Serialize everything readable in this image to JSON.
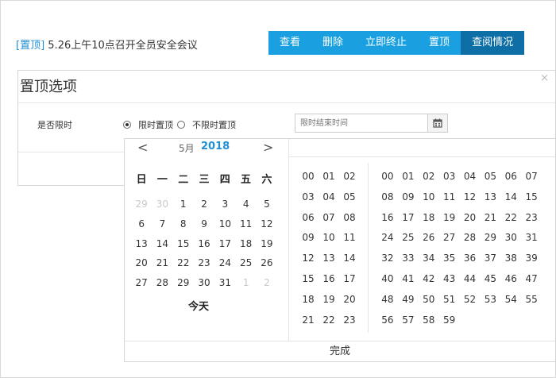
{
  "notice": {
    "tag": "[置顶]",
    "text": " 5.26上午10点召开全员安全会议"
  },
  "toolbar": {
    "buttons": [
      "查看",
      "删除",
      "立即终止",
      "置顶",
      "查阅情况"
    ]
  },
  "modal": {
    "title": "置顶选项",
    "close": "×",
    "limit_label": "是否限时",
    "radio_limited": "限时置顶",
    "radio_unlimited": "不限时置顶",
    "end_time_placeholder": "限时结束时间"
  },
  "picker": {
    "prev": "<",
    "next": ">",
    "month": "5月",
    "year": "2018",
    "weekdays": [
      "日",
      "一",
      "二",
      "三",
      "四",
      "五",
      "六"
    ],
    "days": [
      "29",
      "30",
      "1",
      "2",
      "3",
      "4",
      "5",
      "6",
      "7",
      "8",
      "9",
      "10",
      "11",
      "12",
      "13",
      "14",
      "15",
      "16",
      "17",
      "18",
      "19",
      "20",
      "21",
      "22",
      "23",
      "24",
      "25",
      "26",
      "27",
      "28",
      "29",
      "30",
      "31",
      "1",
      "2"
    ],
    "today": "今天",
    "hours": [
      "00",
      "01",
      "02",
      "03",
      "04",
      "05",
      "06",
      "07",
      "08",
      "09",
      "10",
      "11",
      "12",
      "13",
      "14",
      "15",
      "16",
      "17",
      "18",
      "19",
      "20",
      "21",
      "22",
      "23"
    ],
    "minutes": [
      "00",
      "01",
      "02",
      "03",
      "04",
      "05",
      "06",
      "07",
      "08",
      "09",
      "10",
      "11",
      "12",
      "13",
      "14",
      "15",
      "16",
      "17",
      "18",
      "19",
      "20",
      "21",
      "22",
      "23",
      "24",
      "25",
      "26",
      "27",
      "28",
      "29",
      "30",
      "31",
      "32",
      "33",
      "34",
      "35",
      "36",
      "37",
      "38",
      "39",
      "40",
      "41",
      "42",
      "43",
      "44",
      "45",
      "46",
      "47",
      "48",
      "49",
      "50",
      "51",
      "52",
      "53",
      "54",
      "55",
      "56",
      "57",
      "58",
      "59"
    ],
    "done": "完成"
  }
}
